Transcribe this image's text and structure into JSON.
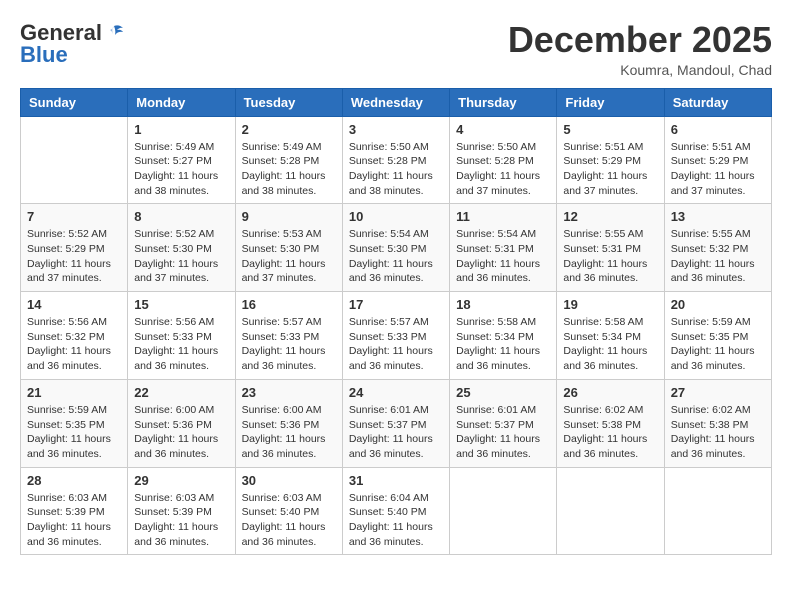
{
  "header": {
    "logo_general": "General",
    "logo_blue": "Blue",
    "month": "December 2025",
    "location": "Koumra, Mandoul, Chad"
  },
  "days_of_week": [
    "Sunday",
    "Monday",
    "Tuesday",
    "Wednesday",
    "Thursday",
    "Friday",
    "Saturday"
  ],
  "weeks": [
    [
      {
        "day": "",
        "info": ""
      },
      {
        "day": "1",
        "info": "Sunrise: 5:49 AM\nSunset: 5:27 PM\nDaylight: 11 hours and 38 minutes."
      },
      {
        "day": "2",
        "info": "Sunrise: 5:49 AM\nSunset: 5:28 PM\nDaylight: 11 hours and 38 minutes."
      },
      {
        "day": "3",
        "info": "Sunrise: 5:50 AM\nSunset: 5:28 PM\nDaylight: 11 hours and 38 minutes."
      },
      {
        "day": "4",
        "info": "Sunrise: 5:50 AM\nSunset: 5:28 PM\nDaylight: 11 hours and 37 minutes."
      },
      {
        "day": "5",
        "info": "Sunrise: 5:51 AM\nSunset: 5:29 PM\nDaylight: 11 hours and 37 minutes."
      },
      {
        "day": "6",
        "info": "Sunrise: 5:51 AM\nSunset: 5:29 PM\nDaylight: 11 hours and 37 minutes."
      }
    ],
    [
      {
        "day": "7",
        "info": "Sunrise: 5:52 AM\nSunset: 5:29 PM\nDaylight: 11 hours and 37 minutes."
      },
      {
        "day": "8",
        "info": "Sunrise: 5:52 AM\nSunset: 5:30 PM\nDaylight: 11 hours and 37 minutes."
      },
      {
        "day": "9",
        "info": "Sunrise: 5:53 AM\nSunset: 5:30 PM\nDaylight: 11 hours and 37 minutes."
      },
      {
        "day": "10",
        "info": "Sunrise: 5:54 AM\nSunset: 5:30 PM\nDaylight: 11 hours and 36 minutes."
      },
      {
        "day": "11",
        "info": "Sunrise: 5:54 AM\nSunset: 5:31 PM\nDaylight: 11 hours and 36 minutes."
      },
      {
        "day": "12",
        "info": "Sunrise: 5:55 AM\nSunset: 5:31 PM\nDaylight: 11 hours and 36 minutes."
      },
      {
        "day": "13",
        "info": "Sunrise: 5:55 AM\nSunset: 5:32 PM\nDaylight: 11 hours and 36 minutes."
      }
    ],
    [
      {
        "day": "14",
        "info": "Sunrise: 5:56 AM\nSunset: 5:32 PM\nDaylight: 11 hours and 36 minutes."
      },
      {
        "day": "15",
        "info": "Sunrise: 5:56 AM\nSunset: 5:33 PM\nDaylight: 11 hours and 36 minutes."
      },
      {
        "day": "16",
        "info": "Sunrise: 5:57 AM\nSunset: 5:33 PM\nDaylight: 11 hours and 36 minutes."
      },
      {
        "day": "17",
        "info": "Sunrise: 5:57 AM\nSunset: 5:33 PM\nDaylight: 11 hours and 36 minutes."
      },
      {
        "day": "18",
        "info": "Sunrise: 5:58 AM\nSunset: 5:34 PM\nDaylight: 11 hours and 36 minutes."
      },
      {
        "day": "19",
        "info": "Sunrise: 5:58 AM\nSunset: 5:34 PM\nDaylight: 11 hours and 36 minutes."
      },
      {
        "day": "20",
        "info": "Sunrise: 5:59 AM\nSunset: 5:35 PM\nDaylight: 11 hours and 36 minutes."
      }
    ],
    [
      {
        "day": "21",
        "info": "Sunrise: 5:59 AM\nSunset: 5:35 PM\nDaylight: 11 hours and 36 minutes."
      },
      {
        "day": "22",
        "info": "Sunrise: 6:00 AM\nSunset: 5:36 PM\nDaylight: 11 hours and 36 minutes."
      },
      {
        "day": "23",
        "info": "Sunrise: 6:00 AM\nSunset: 5:36 PM\nDaylight: 11 hours and 36 minutes."
      },
      {
        "day": "24",
        "info": "Sunrise: 6:01 AM\nSunset: 5:37 PM\nDaylight: 11 hours and 36 minutes."
      },
      {
        "day": "25",
        "info": "Sunrise: 6:01 AM\nSunset: 5:37 PM\nDaylight: 11 hours and 36 minutes."
      },
      {
        "day": "26",
        "info": "Sunrise: 6:02 AM\nSunset: 5:38 PM\nDaylight: 11 hours and 36 minutes."
      },
      {
        "day": "27",
        "info": "Sunrise: 6:02 AM\nSunset: 5:38 PM\nDaylight: 11 hours and 36 minutes."
      }
    ],
    [
      {
        "day": "28",
        "info": "Sunrise: 6:03 AM\nSunset: 5:39 PM\nDaylight: 11 hours and 36 minutes."
      },
      {
        "day": "29",
        "info": "Sunrise: 6:03 AM\nSunset: 5:39 PM\nDaylight: 11 hours and 36 minutes."
      },
      {
        "day": "30",
        "info": "Sunrise: 6:03 AM\nSunset: 5:40 PM\nDaylight: 11 hours and 36 minutes."
      },
      {
        "day": "31",
        "info": "Sunrise: 6:04 AM\nSunset: 5:40 PM\nDaylight: 11 hours and 36 minutes."
      },
      {
        "day": "",
        "info": ""
      },
      {
        "day": "",
        "info": ""
      },
      {
        "day": "",
        "info": ""
      }
    ]
  ]
}
